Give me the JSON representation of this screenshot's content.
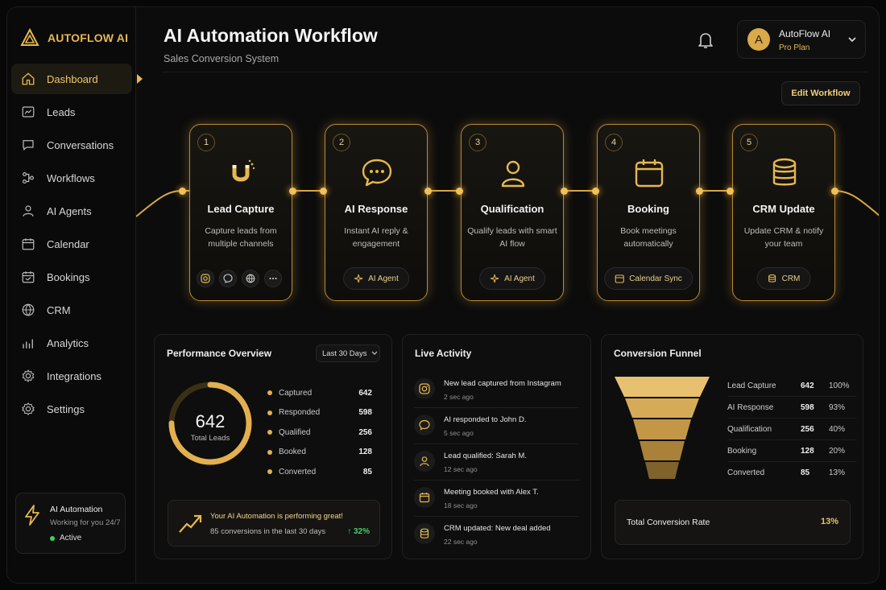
{
  "brand": {
    "name": "AUTOFLOW AI"
  },
  "sidebar": {
    "items": [
      {
        "label": "Dashboard",
        "icon": "home-icon"
      },
      {
        "label": "Leads",
        "icon": "leads-icon"
      },
      {
        "label": "Conversations",
        "icon": "chat-icon"
      },
      {
        "label": "Workflows",
        "icon": "workflow-icon"
      },
      {
        "label": "AI Agents",
        "icon": "user-icon"
      },
      {
        "label": "Calendar",
        "icon": "calendar-icon"
      },
      {
        "label": "Bookings",
        "icon": "calendar-check-icon"
      },
      {
        "label": "CRM",
        "icon": "globe-icon"
      },
      {
        "label": "Analytics",
        "icon": "analytics-icon"
      },
      {
        "label": "Integrations",
        "icon": "gear-icon"
      },
      {
        "label": "Settings",
        "icon": "settings-icon"
      }
    ],
    "automation": {
      "title": "AI Automation",
      "subtitle": "Working for you 24/7",
      "status": "Active"
    }
  },
  "header": {
    "title": "AI Automation Workflow",
    "subtitle": "Sales Conversion System",
    "user": {
      "initial": "A",
      "name": "AutoFlow AI",
      "plan": "Pro Plan"
    },
    "edit_label": "Edit Workflow"
  },
  "workflow": {
    "steps": [
      {
        "num": "1",
        "title": "Lead Capture",
        "desc": "Capture leads from multiple channels",
        "icon": "magnet-icon"
      },
      {
        "num": "2",
        "title": "AI Response",
        "desc": "Instant AI reply & engagement",
        "icon": "chat-bubble-icon",
        "pill": "AI Agent"
      },
      {
        "num": "3",
        "title": "Qualification",
        "desc": "Qualify leads with smart AI flow",
        "icon": "user-icon",
        "pill": "AI Agent"
      },
      {
        "num": "4",
        "title": "Booking",
        "desc": "Book meetings automatically",
        "icon": "calendar-icon",
        "pill": "Calendar Sync"
      },
      {
        "num": "5",
        "title": "CRM Update",
        "desc": "Update CRM & notify your team",
        "icon": "database-icon",
        "pill": "CRM"
      }
    ]
  },
  "performance": {
    "title": "Performance Overview",
    "range": "Last 30 Days",
    "total": "642",
    "total_label": "Total Leads",
    "stats": [
      {
        "label": "Captured",
        "value": "642"
      },
      {
        "label": "Responded",
        "value": "598"
      },
      {
        "label": "Qualified",
        "value": "256"
      },
      {
        "label": "Booked",
        "value": "128"
      },
      {
        "label": "Converted",
        "value": "85"
      }
    ],
    "banner": {
      "title": "Your AI Automation is performing great!",
      "text": "85 conversions in the last 30 days",
      "change": "↑ 32%"
    }
  },
  "activity": {
    "title": "Live Activity",
    "items": [
      {
        "text": "New lead captured from Instagram",
        "time": "2 sec ago",
        "icon": "instagram-icon"
      },
      {
        "text": "AI responded to John D.",
        "time": "5 sec ago",
        "icon": "chat-icon"
      },
      {
        "text": "Lead qualified: Sarah M.",
        "time": "12 sec ago",
        "icon": "user-icon"
      },
      {
        "text": "Meeting booked with Alex T.",
        "time": "18 sec ago",
        "icon": "calendar-icon"
      },
      {
        "text": "CRM updated: New deal added",
        "time": "22 sec ago",
        "icon": "database-icon"
      }
    ]
  },
  "funnel": {
    "title": "Conversion Funnel",
    "rows": [
      {
        "label": "Lead Capture",
        "value": "642",
        "pct": "100%"
      },
      {
        "label": "AI Response",
        "value": "598",
        "pct": "93%"
      },
      {
        "label": "Qualification",
        "value": "256",
        "pct": "40%"
      },
      {
        "label": "Booking",
        "value": "128",
        "pct": "20%"
      },
      {
        "label": "Converted",
        "value": "85",
        "pct": "13%"
      }
    ],
    "total_label": "Total Conversion Rate",
    "total_value": "13%"
  },
  "colors": {
    "accent": "#E6B84F",
    "success": "#45D16A",
    "background": "#0C0C0C"
  }
}
